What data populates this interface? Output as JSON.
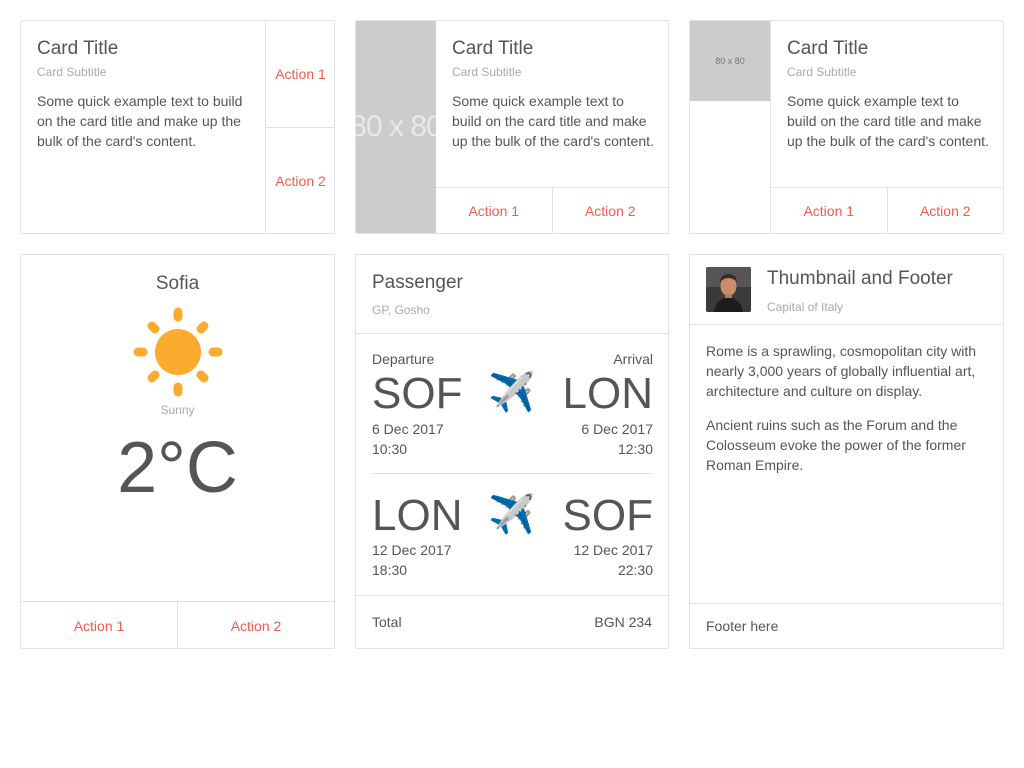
{
  "card1": {
    "title": "Card Title",
    "subtitle": "Card Subtitle",
    "text": "Some quick example text to build on the card title and make up the bulk of the card's content.",
    "action1": "Action 1",
    "action2": "Action 2"
  },
  "card2": {
    "media_label": "80 x 80",
    "title": "Card Title",
    "subtitle": "Card Subtitle",
    "text": "Some quick example text to build on the card title and make up the bulk of the card's content.",
    "action1": "Action 1",
    "action2": "Action 2"
  },
  "card3": {
    "media_label": "80 x 80",
    "title": "Card Title",
    "subtitle": "Card Subtitle",
    "text": "Some quick example text to build on the card title and make up the bulk of the card's content.",
    "action1": "Action 1",
    "action2": "Action 2"
  },
  "weather": {
    "city": "Sofia",
    "icon": "sun-icon",
    "condition": "Sunny",
    "temperature": "2°C",
    "action1": "Action 1",
    "action2": "Action 2"
  },
  "flight": {
    "title": "Passenger",
    "subtitle": "GP, Gosho",
    "departure_label": "Departure",
    "arrival_label": "Arrival",
    "plane_icon": "✈️",
    "outbound": {
      "from": "SOF",
      "to": "LON",
      "dep_date": "6 Dec 2017",
      "dep_time": "10:30",
      "arr_date": "6 Dec 2017",
      "arr_time": "12:30"
    },
    "return": {
      "from": "LON",
      "to": "SOF",
      "dep_date": "12 Dec 2017",
      "dep_time": "18:30",
      "arr_date": "12 Dec 2017",
      "arr_time": "22:30"
    },
    "total_label": "Total",
    "total_value": "BGN 234"
  },
  "thumbnail": {
    "title": "Thumbnail and Footer",
    "subtitle": "Capital of Italy",
    "paragraph1": "Rome is a sprawling, cosmopolitan city with nearly 3,000 years of globally influential art, architecture and culture on display.",
    "paragraph2": "Ancient ruins such as the Forum and the Colosseum evoke the power of the former Roman Empire.",
    "footer": "Footer here"
  },
  "colors": {
    "accent": "#f25c4a",
    "sun": "#fbab2e",
    "border": "#e3e3e3"
  }
}
